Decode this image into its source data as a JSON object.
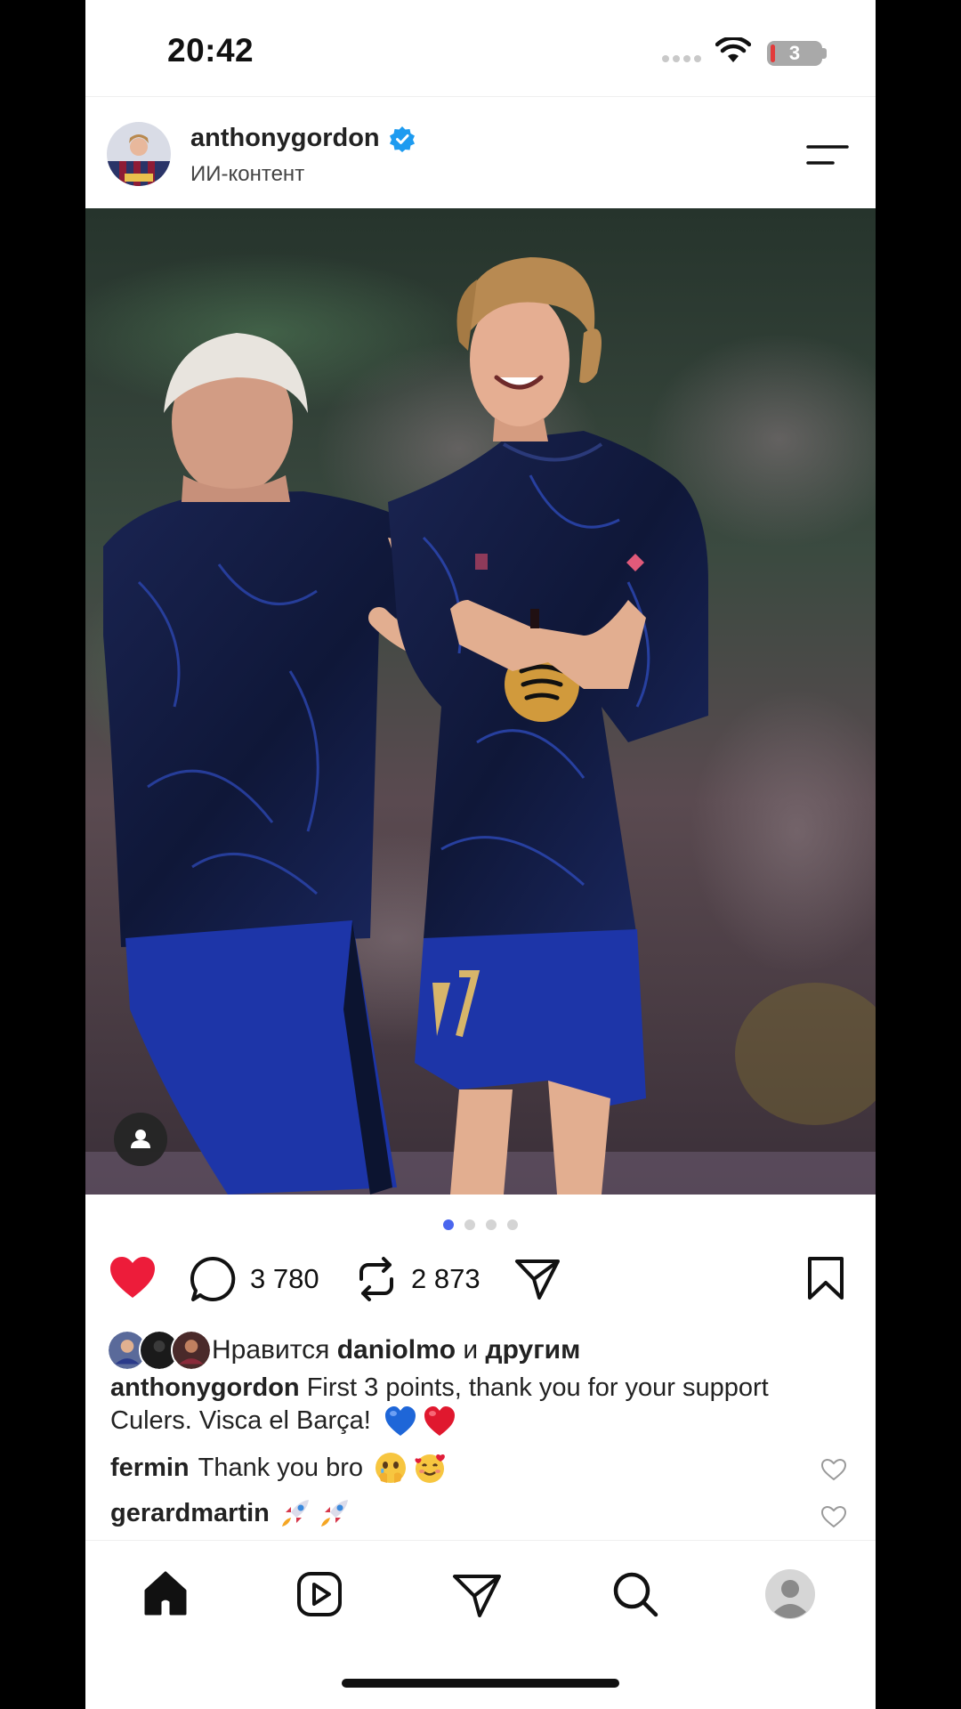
{
  "status_bar": {
    "time": "20:42",
    "battery_level": "3"
  },
  "post": {
    "username": "anthonygordon",
    "subtitle": "ИИ-контент",
    "verified": true,
    "carousel": {
      "total": 4,
      "active": 1
    },
    "actions": {
      "liked": true,
      "comments_count": "3 780",
      "reposts_count": "2 873"
    },
    "likes": {
      "prefix": "Нравится",
      "user": "daniolmo",
      "connector": "и",
      "suffix": "другим"
    },
    "caption": {
      "user": "anthonygordon",
      "text": "First 3 points, thank you for your support Culers. Visca el Barça!",
      "emoji": [
        "blue-heart",
        "red-heart"
      ]
    },
    "comments": [
      {
        "user": "fermin",
        "text": "Thank you bro",
        "emoji": [
          "face-holding-back-tears",
          "smiling-face-with-hearts"
        ]
      },
      {
        "user": "gerardmartin",
        "text": "",
        "emoji": [
          "rocket",
          "rocket"
        ]
      }
    ]
  },
  "nav": {
    "items": [
      "home-icon",
      "reels-icon",
      "direct-icon",
      "search-icon",
      "profile-icon"
    ]
  },
  "colors": {
    "like_red": "#ed1c3a",
    "verified_blue": "#1d9bf0",
    "active_dot": "#4a66ee",
    "jersey_navy": "#121b3d",
    "shorts_blue": "#1d35a8"
  }
}
